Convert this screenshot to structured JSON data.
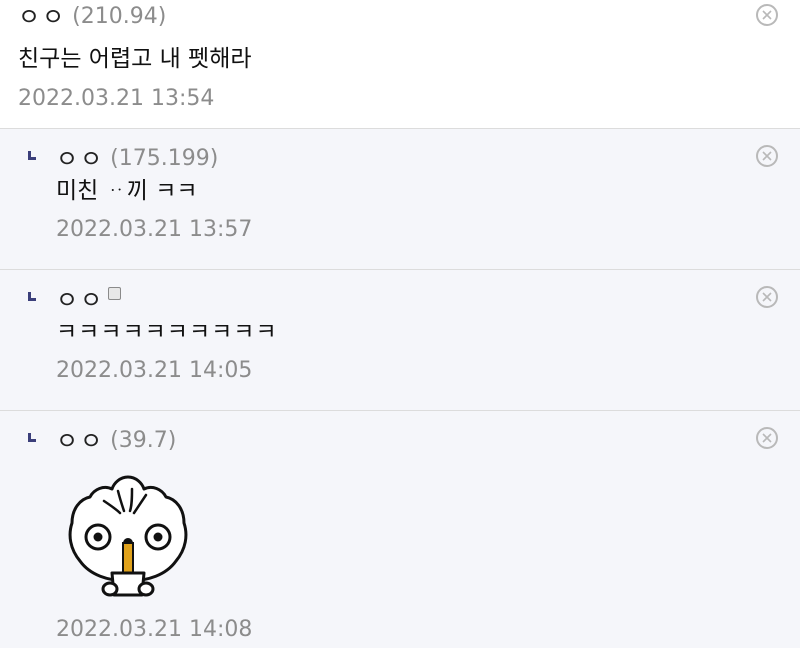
{
  "comments": [
    {
      "nickname": "ㅇㅇ",
      "ip": "(210.94)",
      "text": "친구는 어렵고 내 펫해라",
      "time": "2022.03.21 13:54"
    }
  ],
  "replies": [
    {
      "nickname": "ㅇㅇ",
      "ip": "(175.199)",
      "text": "미친 ᆢ끼 ㅋㅋ",
      "time": "2022.03.21 13:57"
    },
    {
      "nickname": "ㅇㅇ",
      "ip": "",
      "text": "ㅋㅋㅋㅋㅋㅋㅋㅋㅋㅋ",
      "time": "2022.03.21 14:05"
    },
    {
      "nickname": "ㅇㅇ",
      "ip": "(39.7)",
      "text": "",
      "time": "2022.03.21 14:08",
      "sticker": "dumpling-sticker"
    }
  ],
  "icons": {
    "delete": "close-circle-icon",
    "reply": "reply-arrow-icon",
    "member_badge": "badge-icon"
  },
  "colors": {
    "reply_background": "#f5f6fa",
    "meta_gray": "#8c8c8c",
    "reply_mark": "#3b3f7a"
  }
}
